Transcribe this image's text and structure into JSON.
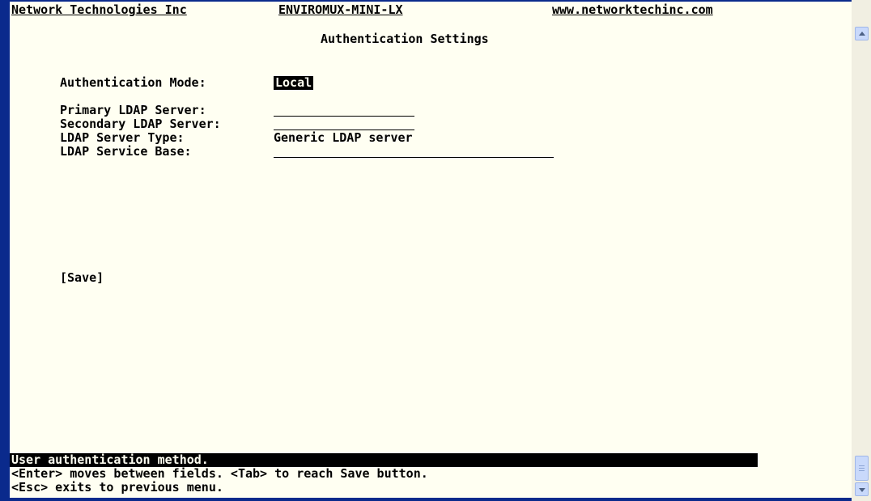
{
  "header": {
    "company": "Network Technologies Inc",
    "product": "ENVIROMUX-MINI-LX",
    "website": "www.networktechinc.com"
  },
  "page_title": "Authentication Settings",
  "auth_mode": {
    "label": "Authentication Mode:",
    "value": "Local"
  },
  "fields": {
    "primary_ldap": {
      "label": "Primary LDAP Server:",
      "value": ""
    },
    "secondary_ldap": {
      "label": "Secondary LDAP Server:",
      "value": ""
    },
    "server_type": {
      "label": "LDAP Server Type:",
      "value": "Generic LDAP server"
    },
    "service_base": {
      "label": "LDAP Service Base:",
      "value": ""
    }
  },
  "save_label": "[Save]",
  "status": "User authentication method.",
  "help": {
    "line1": "<Enter> moves between fields. <Tab> to reach Save button.",
    "line2": "<Esc> exits to previous menu."
  },
  "colors": {
    "background": "#fffff2",
    "text": "#000000",
    "frame": "#0a2a8c"
  }
}
